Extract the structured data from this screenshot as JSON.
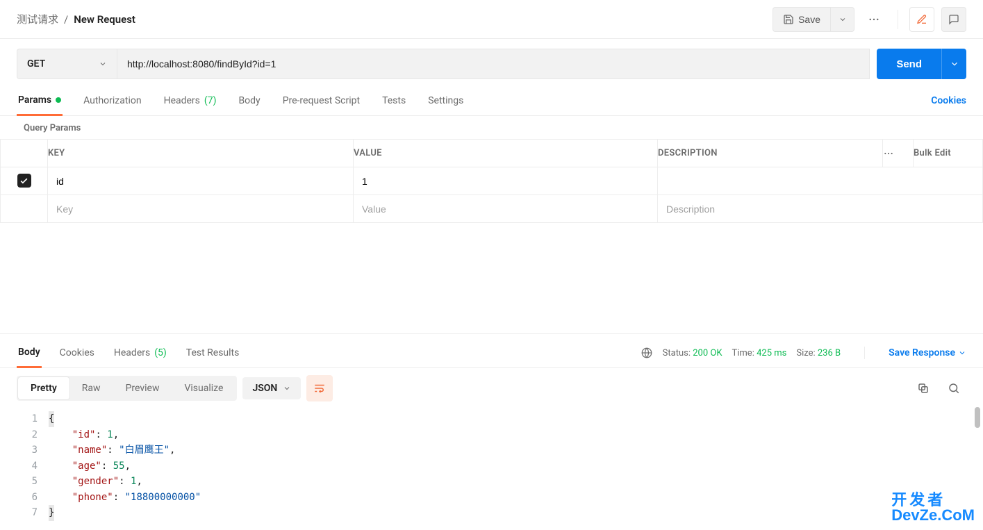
{
  "breadcrumb": {
    "folder": "测试请求",
    "name": "New Request"
  },
  "toolbar": {
    "save_label": "Save"
  },
  "request": {
    "method": "GET",
    "url": "http://localhost:8080/findById?id=1",
    "send_label": "Send"
  },
  "req_tabs": {
    "params": "Params",
    "auth": "Authorization",
    "headers": "Headers",
    "headers_count": "(7)",
    "body": "Body",
    "prereq": "Pre-request Script",
    "tests": "Tests",
    "settings": "Settings",
    "cookies": "Cookies"
  },
  "section_title": "Query Params",
  "table": {
    "headers": {
      "key": "KEY",
      "value": "VALUE",
      "desc": "DESCRIPTION",
      "bulk": "Bulk Edit"
    },
    "rows": [
      {
        "key": "id",
        "value": "1",
        "desc": ""
      }
    ],
    "placeholders": {
      "key": "Key",
      "value": "Value",
      "desc": "Description"
    }
  },
  "response": {
    "tabs": {
      "body": "Body",
      "cookies": "Cookies",
      "headers": "Headers",
      "headers_count": "(5)",
      "test": "Test Results"
    },
    "meta": {
      "status_label": "Status:",
      "status_value": "200 OK",
      "time_label": "Time:",
      "time_value": "425 ms",
      "size_label": "Size:",
      "size_value": "236 B"
    },
    "save_label": "Save Response",
    "view": {
      "pretty": "Pretty",
      "raw": "Raw",
      "preview": "Preview",
      "visualize": "Visualize",
      "lang": "JSON"
    },
    "json": {
      "id": 1,
      "name": "白眉鹰王",
      "age": 55,
      "gender": 1,
      "phone": "18800000000"
    }
  },
  "watermark": {
    "l1": "开发者",
    "l2": "DevZe.CoM"
  },
  "icons": {
    "dots": "⋯",
    "check": "✓",
    "caret": "▾"
  }
}
